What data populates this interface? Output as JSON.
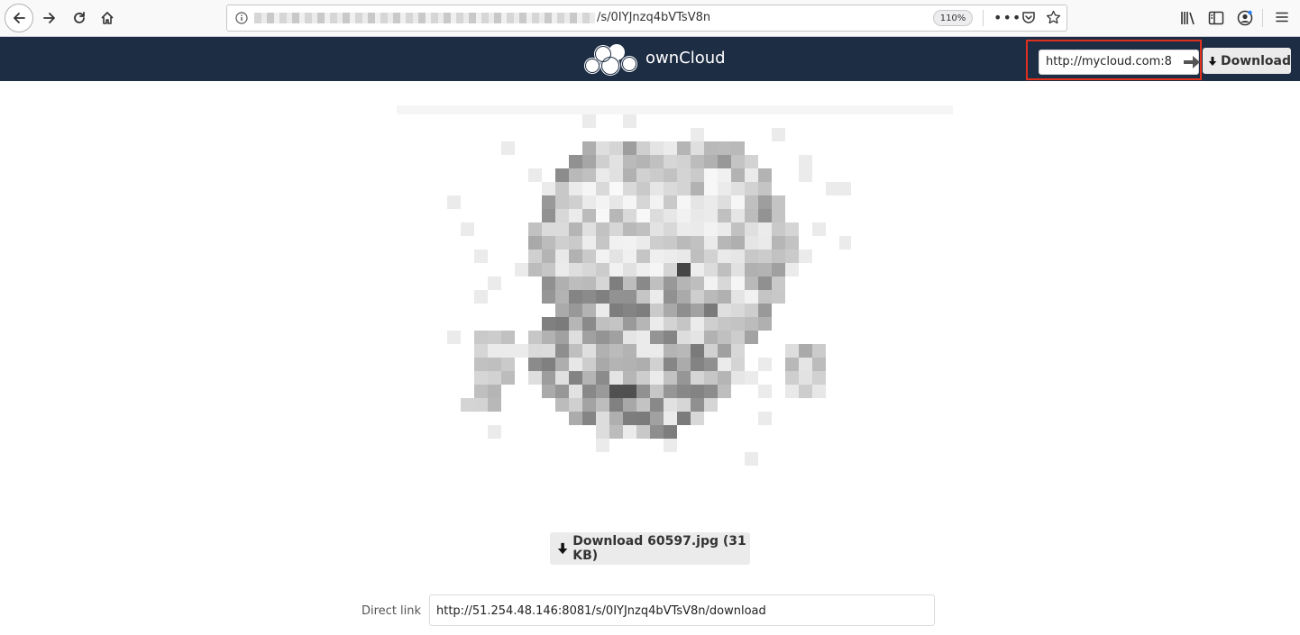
{
  "browser": {
    "url_path": "/s/0IYJnzq4bVTsV8n",
    "zoom": "110%"
  },
  "header": {
    "app_name": "ownCloud",
    "remote_url_value": "http://mycloud.com:8",
    "download_label": "Download"
  },
  "main": {
    "file_download_label": "Download 60597.jpg (31 KB)",
    "direct_link_label": "Direct link",
    "direct_link_value": "http://51.254.48.146:8081/s/0IYJnzq4bVTsV8n/download"
  },
  "colors": {
    "header_bg": "#1d2d44",
    "highlight_box": "#e0301e"
  },
  "icons": {
    "back": "back-arrow-icon",
    "forward": "forward-arrow-icon",
    "reload": "reload-icon",
    "home": "home-icon",
    "info": "info-icon",
    "more": "more-dots-icon",
    "pocket": "pocket-icon",
    "bookmark": "star-icon",
    "library": "library-icon",
    "sidebar": "sidebar-icon",
    "account": "account-icon",
    "menu": "hamburger-menu-icon",
    "logo": "owncloud-cloud-logo",
    "submit": "arrow-right-icon",
    "download": "download-arrow-icon"
  }
}
